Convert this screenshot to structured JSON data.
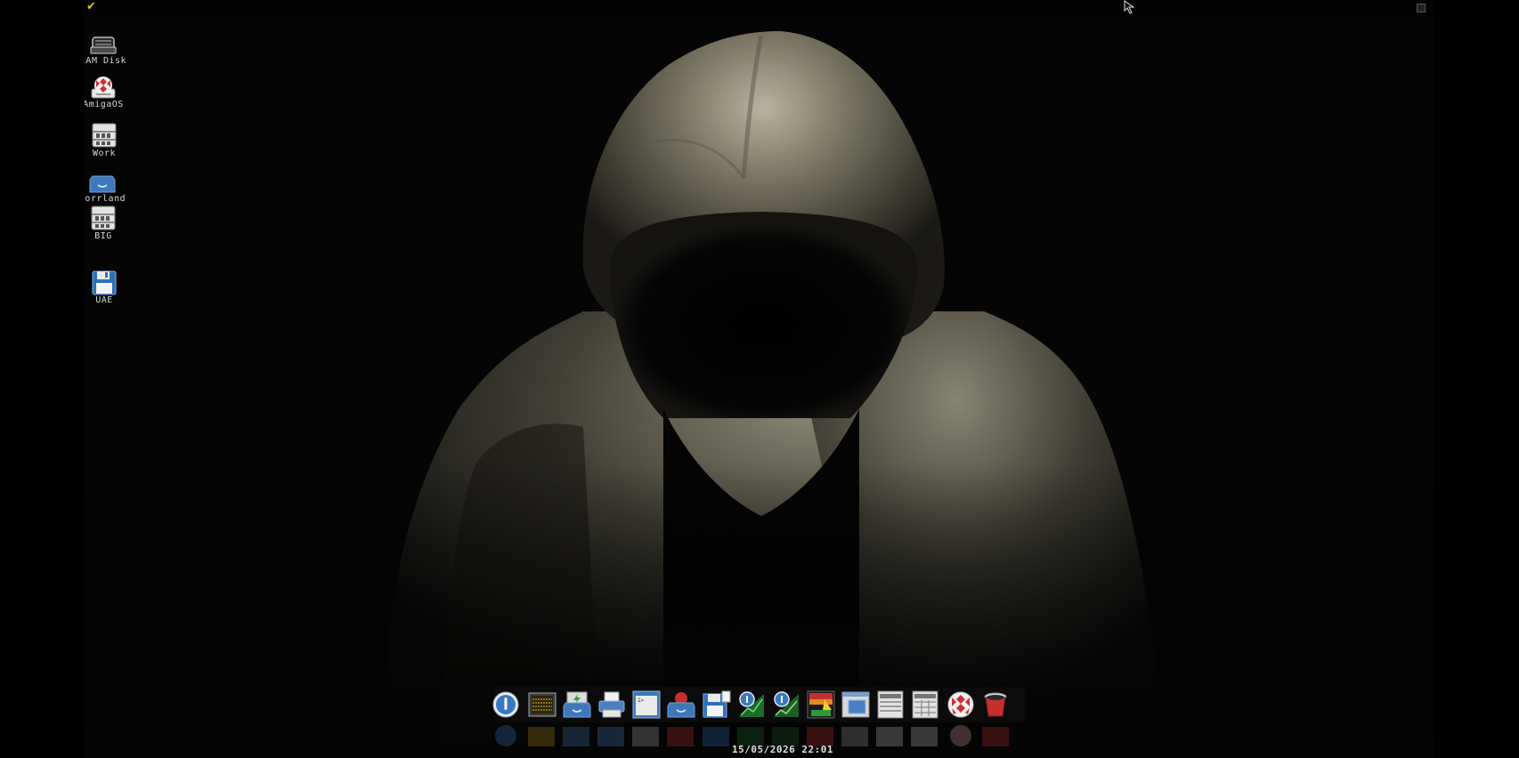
{
  "desktop": {
    "icons": [
      {
        "label": "RAM Disk",
        "icon": "ram-disk-icon"
      },
      {
        "label": "AmigaOS",
        "icon": "boing-ball-drive-icon"
      },
      {
        "label": "Work",
        "icon": "harddisk-icon"
      },
      {
        "label": "Norrland",
        "icon": "drawer-icon"
      },
      {
        "label": "BIG",
        "icon": "harddisk-icon"
      },
      {
        "label": "UAE",
        "icon": "floppy-disk-icon"
      }
    ]
  },
  "dock": {
    "items": [
      {
        "icon": "info-button-icon"
      },
      {
        "icon": "cpu-monitor-icon"
      },
      {
        "icon": "drawer-lightning-icon"
      },
      {
        "icon": "printer-icon"
      },
      {
        "icon": "shell-window-icon"
      },
      {
        "icon": "drawer-boing-icon"
      },
      {
        "icon": "disk-save-icon"
      },
      {
        "icon": "info-chart-icon"
      },
      {
        "icon": "info-graph-icon"
      },
      {
        "icon": "paint-app-icon"
      },
      {
        "icon": "window-prefs-icon"
      },
      {
        "icon": "cabinet-icon"
      },
      {
        "icon": "cabinet-grid-icon"
      },
      {
        "icon": "boing-ball-icon"
      },
      {
        "icon": "trashcan-icon"
      }
    ]
  },
  "status": {
    "clock": "15/05/2026 22:01"
  },
  "colors": {
    "titlebar_check": "#e8c21a",
    "label_text": "#d8d8d8",
    "dock_bg": "#0b0b0c"
  }
}
